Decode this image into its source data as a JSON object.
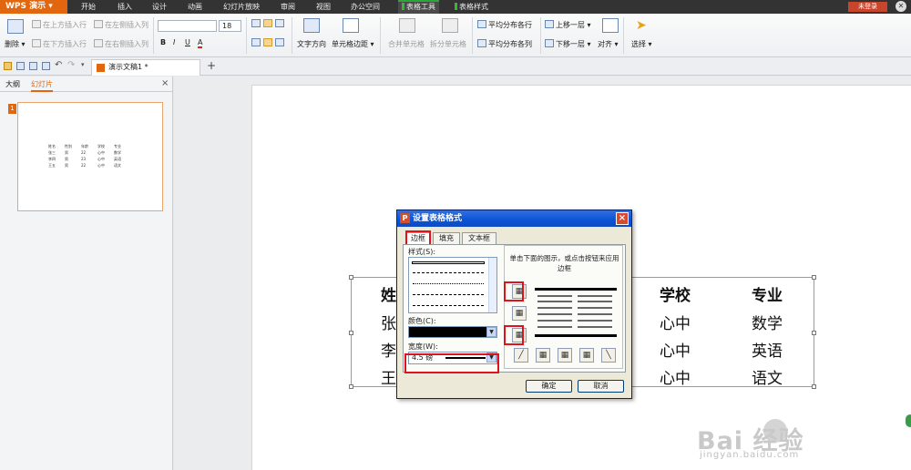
{
  "titlebar": {
    "app_name": "WPS 演示",
    "menu_tabs": [
      "开始",
      "插入",
      "设计",
      "动画",
      "幻灯片放映",
      "审阅",
      "视图",
      "办公空间",
      "表格工具",
      "表格样式"
    ],
    "login": "未登录"
  },
  "ribbon": {
    "delete": "删除",
    "insert_above": "在上方插入行",
    "insert_left": "在左侧插入列",
    "insert_below": "在下方插入行",
    "insert_right": "在右侧插入列",
    "font_name": "",
    "font_size": "18",
    "bold": "B",
    "italic": "I",
    "underline": "U",
    "font_color": "A",
    "text_direction": "文字方向",
    "cell_margin": "单元格边距",
    "merge_cells": "合并单元格",
    "split_cells": "拆分单元格",
    "dist_rows": "平均分布各行",
    "dist_cols": "平均分布各列",
    "bring_forward": "上移一层",
    "send_backward": "下移一层",
    "align": "对齐",
    "select": "选择"
  },
  "tabbar": {
    "doc_tab": "演示文稿1 *",
    "new_tab": "+"
  },
  "leftpanel": {
    "tabs": [
      "大纲",
      "幻灯片"
    ],
    "close": "×",
    "slide_number": "1",
    "thumb_rows": [
      [
        "姓名",
        "性别",
        "年龄",
        "学校",
        "专业"
      ],
      [
        "张三",
        "男",
        "22",
        "心中",
        "数学"
      ],
      [
        "李四",
        "男",
        "23",
        "心中",
        "英语"
      ],
      [
        "王五",
        "男",
        "22",
        "心中",
        "语文"
      ]
    ]
  },
  "slide_table": {
    "col1": [
      "姓",
      "张",
      "李",
      "王"
    ],
    "col4": [
      "学校",
      "心中",
      "心中",
      "心中"
    ],
    "col5": [
      "专业",
      "数学",
      "英语",
      "语文"
    ]
  },
  "dialog": {
    "title": "设置表格格式",
    "close": "×",
    "tabs": [
      "边框",
      "填充",
      "文本框"
    ],
    "style_label": "样式(S):",
    "color_label": "颜色(C):",
    "width_label": "宽度(W):",
    "width_value": "4.5 磅",
    "hint": "单击下面的图示，或点击按钮来应用边框",
    "ok": "确定",
    "cancel": "取消",
    "border_color": "#000000",
    "highlight_color": "#e0121b"
  },
  "watermark": {
    "brand": "Bai 经验",
    "url": "jingyan.baidu.com"
  }
}
